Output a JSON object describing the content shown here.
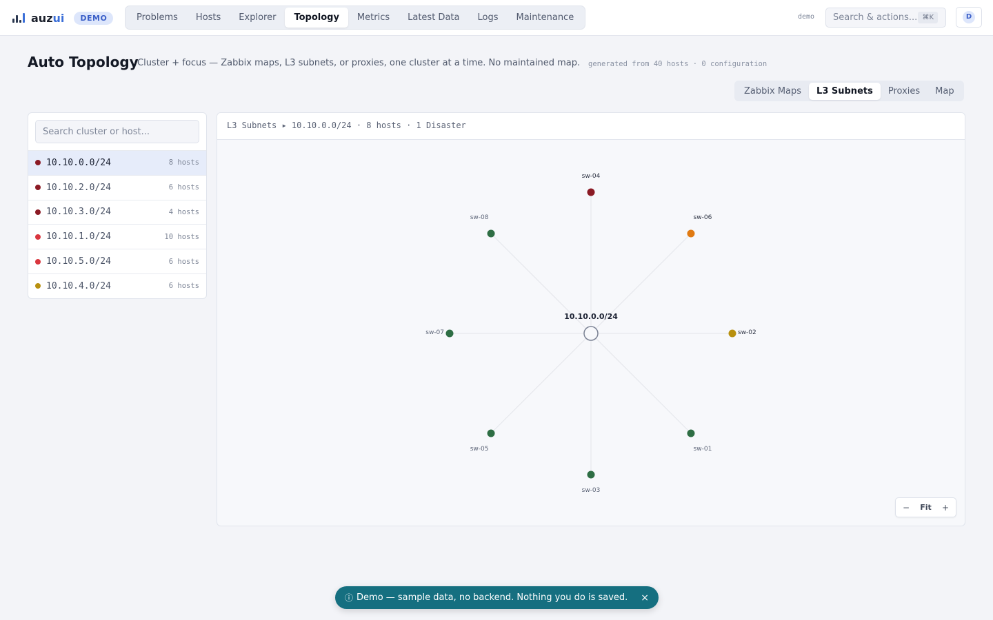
{
  "app": {
    "name_main": "auz",
    "name_accent": "ui",
    "badge": "DEMO"
  },
  "nav": {
    "tabs": [
      {
        "label": "Problems"
      },
      {
        "label": "Hosts"
      },
      {
        "label": "Explorer"
      },
      {
        "label": "Topology",
        "active": true
      },
      {
        "label": "Metrics"
      },
      {
        "label": "Latest Data"
      },
      {
        "label": "Logs"
      },
      {
        "label": "Maintenance"
      }
    ]
  },
  "topbar": {
    "user": "demo",
    "search_label": "Search & actions...",
    "search_shortcut": "⌘K",
    "avatar_initial": "D"
  },
  "page": {
    "title": "Auto Topology",
    "subtitle": "Cluster + focus — Zabbix maps, L3 subnets, or proxies, one cluster at a time. No maintained map.",
    "meta": "generated from 40 hosts · 0 configuration"
  },
  "view_tabs": [
    {
      "label": "Zabbix Maps"
    },
    {
      "label": "L3 Subnets",
      "active": true
    },
    {
      "label": "Proxies"
    },
    {
      "label": "Map"
    }
  ],
  "clusters": {
    "search_placeholder": "Search cluster or host...",
    "items": [
      {
        "name": "10.10.0.0/24",
        "count": "8 hosts",
        "color": "#8b1a24",
        "selected": true
      },
      {
        "name": "10.10.2.0/24",
        "count": "6 hosts",
        "color": "#8b1a24"
      },
      {
        "name": "10.10.3.0/24",
        "count": "4 hosts",
        "color": "#8b1a24"
      },
      {
        "name": "10.10.1.0/24",
        "count": "10 hosts",
        "color": "#d9363e"
      },
      {
        "name": "10.10.5.0/24",
        "count": "6 hosts",
        "color": "#d9363e"
      },
      {
        "name": "10.10.4.0/24",
        "count": "6 hosts",
        "color": "#b8900f"
      }
    ]
  },
  "graph": {
    "breadcrumb": "L3 Subnets ▸ 10.10.0.0/24 · 8 hosts · 1 Disaster",
    "center_label": "10.10.0.0/24",
    "nodes": [
      {
        "name": "sw-04",
        "color": "#8b1a24"
      },
      {
        "name": "sw-06",
        "color": "#e07a12"
      },
      {
        "name": "sw-02",
        "color": "#b8900f"
      },
      {
        "name": "sw-01",
        "color": "#2e6e44"
      },
      {
        "name": "sw-03",
        "color": "#2e6e44"
      },
      {
        "name": "sw-05",
        "color": "#2e6e44"
      },
      {
        "name": "sw-07",
        "color": "#2e6e44"
      },
      {
        "name": "sw-08",
        "color": "#2e6e44"
      }
    ],
    "zoom": {
      "minus": "−",
      "fit": "Fit",
      "plus": "+"
    }
  },
  "toast": {
    "icon": "ⓘ",
    "text": "Demo — sample data, no backend. Nothing you do is saved.",
    "close": "×"
  }
}
